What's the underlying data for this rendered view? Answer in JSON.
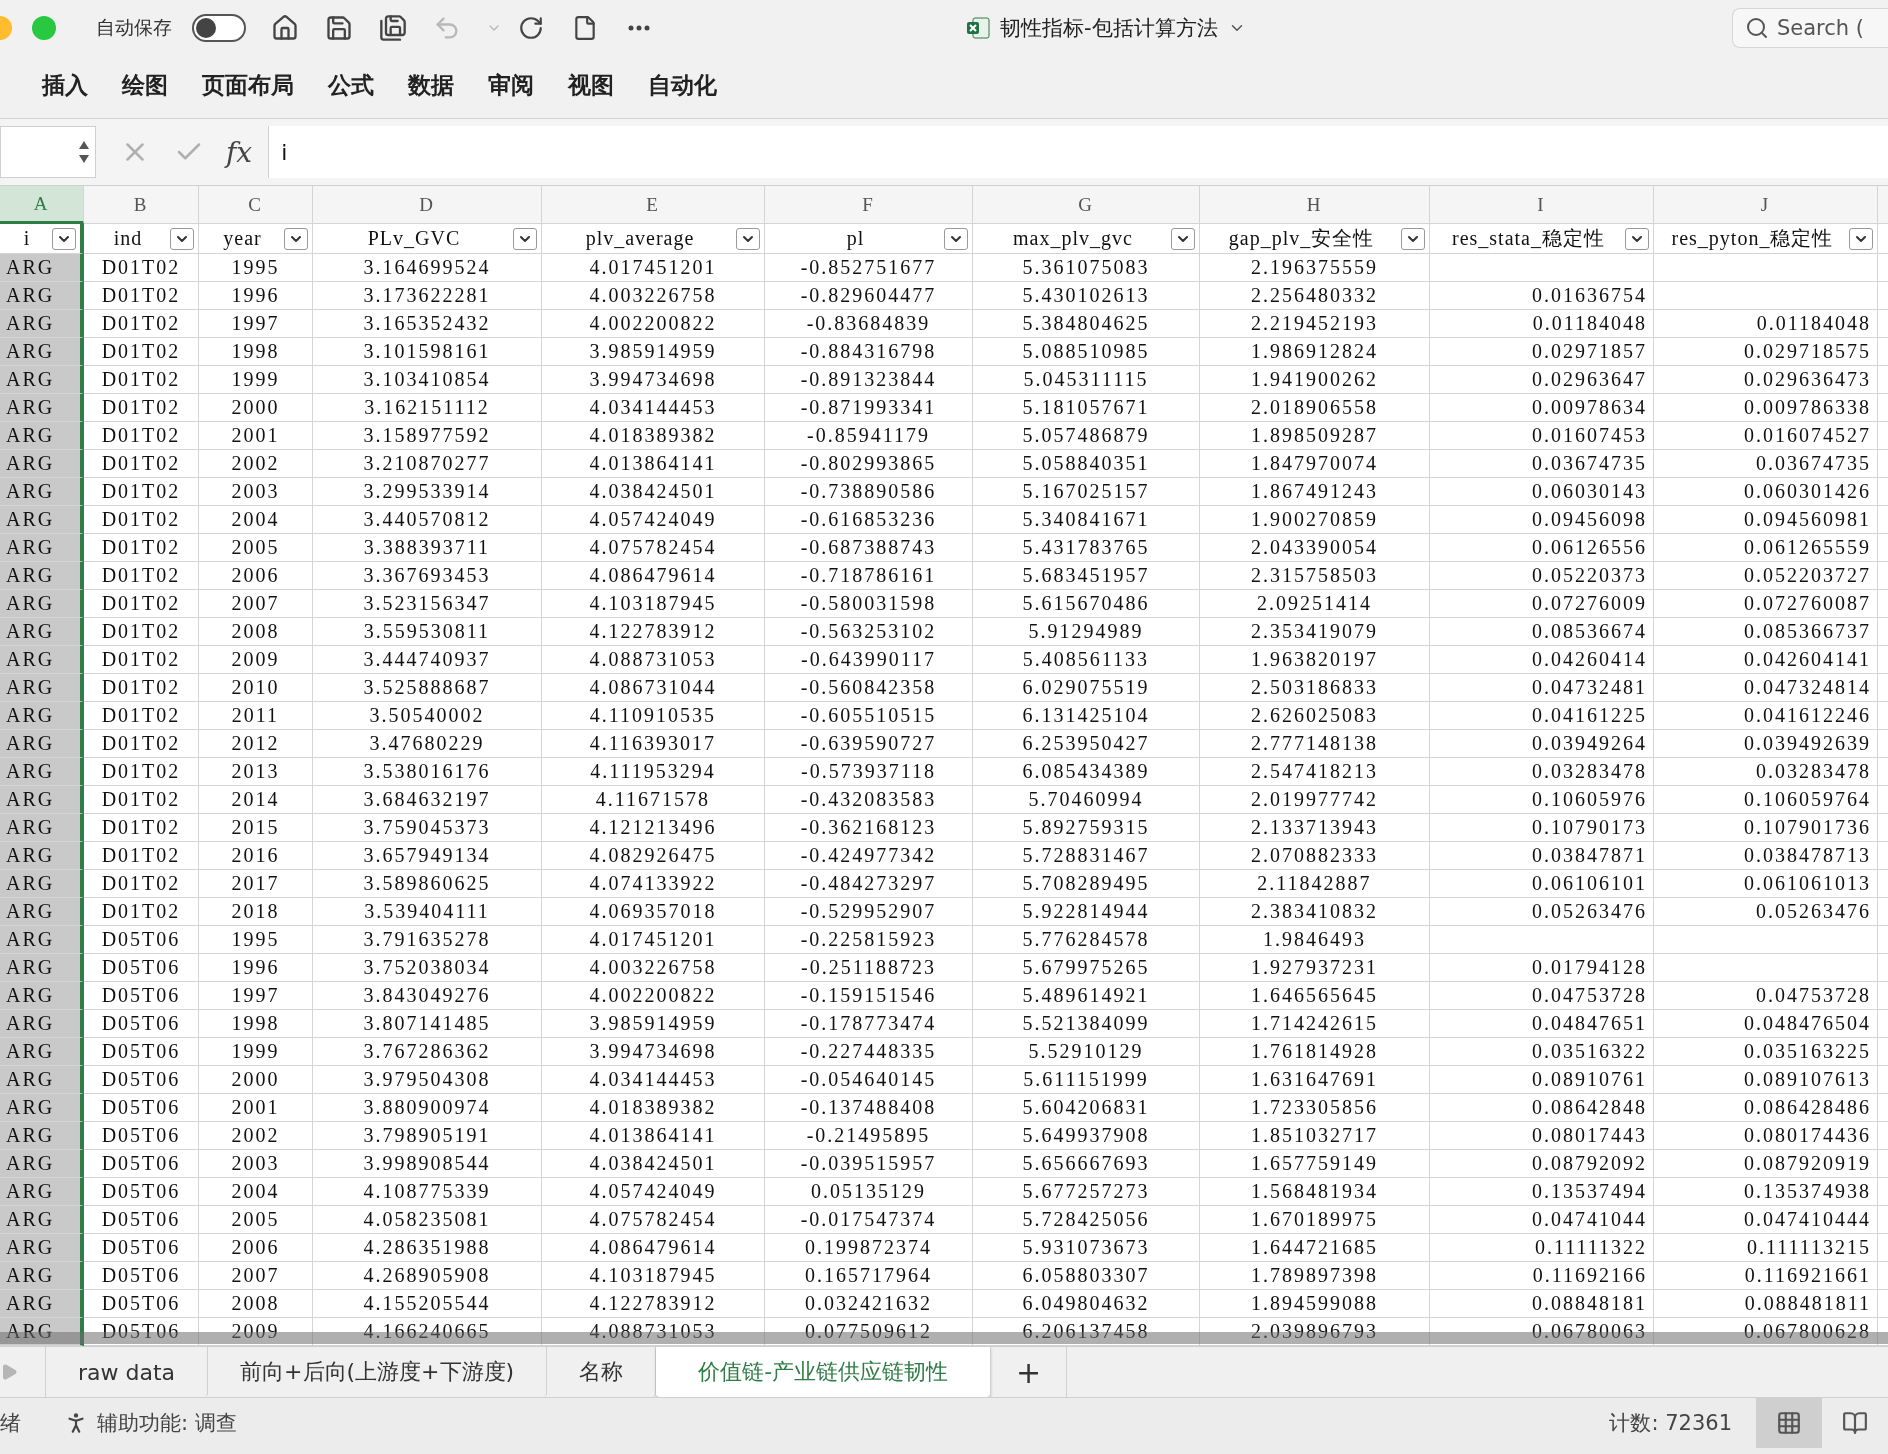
{
  "titlebar": {
    "autosave_label": "自动保存",
    "autosave_on": false,
    "document_title": "韧性指标-包括计算方法",
    "search_placeholder": "Search ("
  },
  "toolbar": [
    {
      "kind": "home",
      "disabled": false
    },
    {
      "kind": "save",
      "disabled": false
    },
    {
      "kind": "save-all",
      "disabled": false
    },
    {
      "kind": "undo",
      "disabled": true
    },
    {
      "kind": "undo-menu",
      "disabled": true
    },
    {
      "kind": "redo",
      "disabled": false
    },
    {
      "kind": "new",
      "disabled": false
    },
    {
      "kind": "more",
      "disabled": false
    }
  ],
  "ribbon_tabs": [
    {
      "label": "插入",
      "selected": false
    },
    {
      "label": "绘图",
      "selected": false
    },
    {
      "label": "页面布局",
      "selected": false
    },
    {
      "label": "公式",
      "selected": false
    },
    {
      "label": "数据",
      "selected": false
    },
    {
      "label": "审阅",
      "selected": false
    },
    {
      "label": "视图",
      "selected": false
    },
    {
      "label": "自动化",
      "selected": false
    }
  ],
  "formula_bar": {
    "fx": "fx",
    "value": "i"
  },
  "column_letters": [
    {
      "label": "A",
      "selected": true
    },
    {
      "label": "B",
      "selected": false
    },
    {
      "label": "C",
      "selected": false
    },
    {
      "label": "D",
      "selected": false
    },
    {
      "label": "E",
      "selected": false
    },
    {
      "label": "F",
      "selected": false
    },
    {
      "label": "G",
      "selected": false
    },
    {
      "label": "H",
      "selected": false
    },
    {
      "label": "I",
      "selected": false
    },
    {
      "label": "J",
      "selected": false
    }
  ],
  "columns": [
    "i",
    "ind",
    "year",
    "PLv_GVC",
    "plv_average",
    "pl",
    "max_plv_gvc",
    "gap_plv_安全性",
    "res_stata_稳定性",
    "res_pyton_稳定性"
  ],
  "rows": [
    [
      "ARG",
      "D01T02",
      "1995",
      "3.164699524",
      "4.017451201",
      "-0.852751677",
      "5.361075083",
      "2.196375559",
      null,
      null
    ],
    [
      "ARG",
      "D01T02",
      "1996",
      "3.173622281",
      "4.003226758",
      "-0.829604477",
      "5.430102613",
      "2.256480332",
      "0.01636754",
      null
    ],
    [
      "ARG",
      "D01T02",
      "1997",
      "3.165352432",
      "4.002200822",
      "-0.83684839",
      "5.384804625",
      "2.219452193",
      "0.01184048",
      "0.01184048"
    ],
    [
      "ARG",
      "D01T02",
      "1998",
      "3.101598161",
      "3.985914959",
      "-0.884316798",
      "5.088510985",
      "1.986912824",
      "0.02971857",
      "0.029718575"
    ],
    [
      "ARG",
      "D01T02",
      "1999",
      "3.103410854",
      "3.994734698",
      "-0.891323844",
      "5.045311115",
      "1.941900262",
      "0.02963647",
      "0.029636473"
    ],
    [
      "ARG",
      "D01T02",
      "2000",
      "3.162151112",
      "4.034144453",
      "-0.871993341",
      "5.181057671",
      "2.018906558",
      "0.00978634",
      "0.009786338"
    ],
    [
      "ARG",
      "D01T02",
      "2001",
      "3.158977592",
      "4.018389382",
      "-0.85941179",
      "5.057486879",
      "1.898509287",
      "0.01607453",
      "0.016074527"
    ],
    [
      "ARG",
      "D01T02",
      "2002",
      "3.210870277",
      "4.013864141",
      "-0.802993865",
      "5.058840351",
      "1.847970074",
      "0.03674735",
      "0.03674735"
    ],
    [
      "ARG",
      "D01T02",
      "2003",
      "3.299533914",
      "4.038424501",
      "-0.738890586",
      "5.167025157",
      "1.867491243",
      "0.06030143",
      "0.060301426"
    ],
    [
      "ARG",
      "D01T02",
      "2004",
      "3.440570812",
      "4.057424049",
      "-0.616853236",
      "5.340841671",
      "1.900270859",
      "0.09456098",
      "0.094560981"
    ],
    [
      "ARG",
      "D01T02",
      "2005",
      "3.388393711",
      "4.075782454",
      "-0.687388743",
      "5.431783765",
      "2.043390054",
      "0.06126556",
      "0.061265559"
    ],
    [
      "ARG",
      "D01T02",
      "2006",
      "3.367693453",
      "4.086479614",
      "-0.718786161",
      "5.683451957",
      "2.315758503",
      "0.05220373",
      "0.052203727"
    ],
    [
      "ARG",
      "D01T02",
      "2007",
      "3.523156347",
      "4.103187945",
      "-0.580031598",
      "5.615670486",
      "2.09251414",
      "0.07276009",
      "0.072760087"
    ],
    [
      "ARG",
      "D01T02",
      "2008",
      "3.559530811",
      "4.122783912",
      "-0.563253102",
      "5.91294989",
      "2.353419079",
      "0.08536674",
      "0.085366737"
    ],
    [
      "ARG",
      "D01T02",
      "2009",
      "3.444740937",
      "4.088731053",
      "-0.643990117",
      "5.408561133",
      "1.963820197",
      "0.04260414",
      "0.042604141"
    ],
    [
      "ARG",
      "D01T02",
      "2010",
      "3.525888687",
      "4.086731044",
      "-0.560842358",
      "6.029075519",
      "2.503186833",
      "0.04732481",
      "0.047324814"
    ],
    [
      "ARG",
      "D01T02",
      "2011",
      "3.50540002",
      "4.110910535",
      "-0.605510515",
      "6.131425104",
      "2.626025083",
      "0.04161225",
      "0.041612246"
    ],
    [
      "ARG",
      "D01T02",
      "2012",
      "3.47680229",
      "4.116393017",
      "-0.639590727",
      "6.253950427",
      "2.777148138",
      "0.03949264",
      "0.039492639"
    ],
    [
      "ARG",
      "D01T02",
      "2013",
      "3.538016176",
      "4.111953294",
      "-0.573937118",
      "6.085434389",
      "2.547418213",
      "0.03283478",
      "0.03283478"
    ],
    [
      "ARG",
      "D01T02",
      "2014",
      "3.684632197",
      "4.11671578",
      "-0.432083583",
      "5.70460994",
      "2.019977742",
      "0.10605976",
      "0.106059764"
    ],
    [
      "ARG",
      "D01T02",
      "2015",
      "3.759045373",
      "4.121213496",
      "-0.362168123",
      "5.892759315",
      "2.133713943",
      "0.10790173",
      "0.107901736"
    ],
    [
      "ARG",
      "D01T02",
      "2016",
      "3.657949134",
      "4.082926475",
      "-0.424977342",
      "5.728831467",
      "2.070882333",
      "0.03847871",
      "0.038478713"
    ],
    [
      "ARG",
      "D01T02",
      "2017",
      "3.589860625",
      "4.074133922",
      "-0.484273297",
      "5.708289495",
      "2.11842887",
      "0.06106101",
      "0.061061013"
    ],
    [
      "ARG",
      "D01T02",
      "2018",
      "3.539404111",
      "4.069357018",
      "-0.529952907",
      "5.922814944",
      "2.383410832",
      "0.05263476",
      "0.05263476"
    ],
    [
      "ARG",
      "D05T06",
      "1995",
      "3.791635278",
      "4.017451201",
      "-0.225815923",
      "5.776284578",
      "1.9846493",
      null,
      null
    ],
    [
      "ARG",
      "D05T06",
      "1996",
      "3.752038034",
      "4.003226758",
      "-0.251188723",
      "5.679975265",
      "1.927937231",
      "0.01794128",
      null
    ],
    [
      "ARG",
      "D05T06",
      "1997",
      "3.843049276",
      "4.002200822",
      "-0.159151546",
      "5.489614921",
      "1.646565645",
      "0.04753728",
      "0.04753728"
    ],
    [
      "ARG",
      "D05T06",
      "1998",
      "3.807141485",
      "3.985914959",
      "-0.178773474",
      "5.521384099",
      "1.714242615",
      "0.04847651",
      "0.048476504"
    ],
    [
      "ARG",
      "D05T06",
      "1999",
      "3.767286362",
      "3.994734698",
      "-0.227448335",
      "5.52910129",
      "1.761814928",
      "0.03516322",
      "0.035163225"
    ],
    [
      "ARG",
      "D05T06",
      "2000",
      "3.979504308",
      "4.034144453",
      "-0.054640145",
      "5.611151999",
      "1.631647691",
      "0.08910761",
      "0.089107613"
    ],
    [
      "ARG",
      "D05T06",
      "2001",
      "3.880900974",
      "4.018389382",
      "-0.137488408",
      "5.604206831",
      "1.723305856",
      "0.08642848",
      "0.086428486"
    ],
    [
      "ARG",
      "D05T06",
      "2002",
      "3.798905191",
      "4.013864141",
      "-0.21495895",
      "5.649937908",
      "1.851032717",
      "0.08017443",
      "0.080174436"
    ],
    [
      "ARG",
      "D05T06",
      "2003",
      "3.998908544",
      "4.038424501",
      "-0.039515957",
      "5.656667693",
      "1.657759149",
      "0.08792092",
      "0.087920919"
    ],
    [
      "ARG",
      "D05T06",
      "2004",
      "4.108775339",
      "4.057424049",
      "0.05135129",
      "5.677257273",
      "1.568481934",
      "0.13537494",
      "0.135374938"
    ],
    [
      "ARG",
      "D05T06",
      "2005",
      "4.058235081",
      "4.075782454",
      "-0.017547374",
      "5.728425056",
      "1.670189975",
      "0.04741044",
      "0.047410444"
    ],
    [
      "ARG",
      "D05T06",
      "2006",
      "4.286351988",
      "4.086479614",
      "0.199872374",
      "5.931073673",
      "1.644721685",
      "0.11111322",
      "0.111113215"
    ],
    [
      "ARG",
      "D05T06",
      "2007",
      "4.268905908",
      "4.103187945",
      "0.165717964",
      "6.058803307",
      "1.789897398",
      "0.11692166",
      "0.116921661"
    ],
    [
      "ARG",
      "D05T06",
      "2008",
      "4.155205544",
      "4.122783912",
      "0.032421632",
      "6.049804632",
      "1.894599088",
      "0.08848181",
      "0.088481811"
    ],
    [
      "ARG",
      "D05T06",
      "2009",
      "4.166240665",
      "4.088731053",
      "0.077509612",
      "6.206137458",
      "2.039896793",
      "0.06780063",
      "0.067800628"
    ]
  ],
  "sheet_tabs": [
    {
      "label": "raw data",
      "selected": false
    },
    {
      "label": "前向+后向(上游度+下游度)",
      "selected": false
    },
    {
      "label": "名称",
      "selected": false
    },
    {
      "label": "价值链-产业链供应链韧性",
      "selected": true
    }
  ],
  "add_sheet": "+",
  "status_bar": {
    "ready": "绪",
    "accessibility": "辅助功能: 调查",
    "count": "计数: 72361",
    "views": [
      {
        "kind": "normal",
        "selected": true
      },
      {
        "kind": "page-layout",
        "selected": false
      }
    ]
  }
}
